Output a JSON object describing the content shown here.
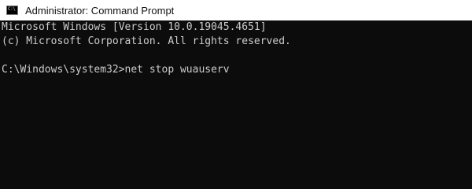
{
  "window": {
    "title": "Administrator: Command Prompt",
    "icon": "cmd-icon",
    "icon_glyph": "C:\\"
  },
  "console": {
    "lines": [
      "Microsoft Windows [Version 10.0.19045.4651]",
      "(c) Microsoft Corporation. All rights reserved.",
      "",
      "C:\\Windows\\system32>net stop wuauserv"
    ],
    "colors": {
      "background": "#0c0c0c",
      "foreground": "#cccccc"
    }
  }
}
